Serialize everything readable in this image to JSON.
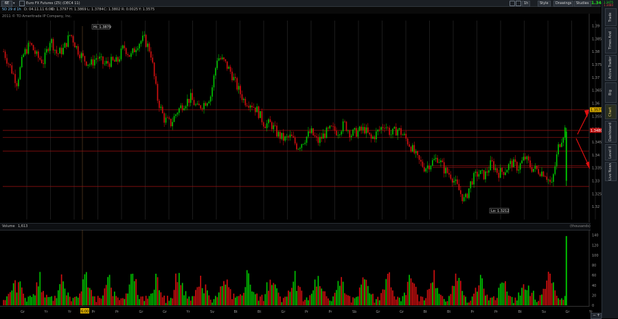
{
  "window": {
    "symbol": "6E",
    "description": "Euro FX Futures (Z5) (DEC4 11)",
    "last_price": "1.348",
    "corner_line1": "1.3475",
    "corner_line2": "1.3480"
  },
  "toolbar": {
    "timeframe": "1h",
    "style_label": "Style",
    "drawings_label": "Drawings",
    "studies_label": "Studies"
  },
  "subbar": {
    "period": "5D 29 d 1h",
    "date": "D: 04.11.11 6:00",
    "open": "O: 1.3797",
    "high": "H: 1.3869",
    "low": "L: 1.3784",
    "close": "C: 1.3802",
    "change": "R: 0.0025",
    "bid": "Y: 1.3575",
    "copyright": "2011 © TD Ameritrade IP Company, Inc."
  },
  "sidebar": {
    "tabs": [
      "Trade",
      "Times And Sales",
      "Active Trader",
      "Big Buttons",
      "Chart",
      "Dashboard",
      "Level II",
      "Live News"
    ],
    "active": "Chart"
  },
  "price_axis": {
    "labels": [
      "1.39",
      "1.385",
      "1.38",
      "1.375",
      "1.37",
      "1.365",
      "1.36",
      "1.355",
      "1.35",
      "1.345",
      "1.34",
      "1.335",
      "1.33",
      "1.325",
      "1.32"
    ]
  },
  "annotations": {
    "hi_label": "Hi: 1.3879",
    "lo_label": "Lo: 1.3212",
    "tag_upper": "1.3575",
    "tag_current": "1.3480"
  },
  "colors": {
    "up": "#00c000",
    "down": "#d01010",
    "level_line": "#8a1010",
    "highlight_tag": "#d4a800",
    "current_tag": "#c01010",
    "arrow": "#e01010"
  },
  "volume": {
    "title": "Volume",
    "value": "1,613",
    "units": "(thousands)",
    "axis_labels": [
      "140",
      "120",
      "100",
      "80",
      "60",
      "40",
      "20",
      "0"
    ]
  },
  "time_axis": {
    "labels": [
      "Gr",
      "Yr",
      "Yr",
      "Pr",
      "Pr",
      "Gr",
      "Gr",
      "Yr",
      "Sv",
      "Bt",
      "Bt",
      "Gr",
      "Pr",
      "Pr",
      "Sb",
      "Gr",
      "Gr",
      "Bt",
      "Bt",
      "Pr",
      "Pr",
      "Bt",
      "Sv",
      "Gr",
      "Yr"
    ],
    "highlight_label": "6:00"
  },
  "chart_data": {
    "type": "candlestick",
    "interval": "1h",
    "ylim": [
      1.315,
      1.392
    ],
    "hi": 1.3879,
    "lo": 1.3212,
    "close_path": [
      1.38,
      1.374,
      1.368,
      1.379,
      1.383,
      1.378,
      1.376,
      1.385,
      1.379,
      1.381,
      1.387,
      1.381,
      1.377,
      1.375,
      1.378,
      1.375,
      1.376,
      1.376,
      1.382,
      1.378,
      1.383,
      1.385,
      1.38,
      1.362,
      1.354,
      1.352,
      1.357,
      1.36,
      1.362,
      1.358,
      1.36,
      1.363,
      1.378,
      1.376,
      1.372,
      1.366,
      1.361,
      1.36,
      1.357,
      1.352,
      1.352,
      1.348,
      1.346,
      1.347,
      1.343,
      1.346,
      1.349,
      1.345,
      1.348,
      1.35,
      1.349,
      1.352,
      1.348,
      1.349,
      1.35,
      1.346,
      1.349,
      1.352,
      1.348,
      1.35,
      1.347,
      1.343,
      1.338,
      1.335,
      1.337,
      1.339,
      1.334,
      1.332,
      1.327,
      1.322,
      1.33,
      1.333,
      1.332,
      1.337,
      1.333,
      1.334,
      1.337,
      1.335,
      1.339,
      1.335,
      1.334,
      1.333,
      1.328,
      1.343,
      1.35
    ],
    "horizontal_levels": [
      1.3575,
      1.3495,
      1.3468,
      1.3415,
      1.3358,
      1.3352,
      1.3278
    ],
    "volume_ylim": [
      0,
      145
    ],
    "volume_spike": 138
  }
}
